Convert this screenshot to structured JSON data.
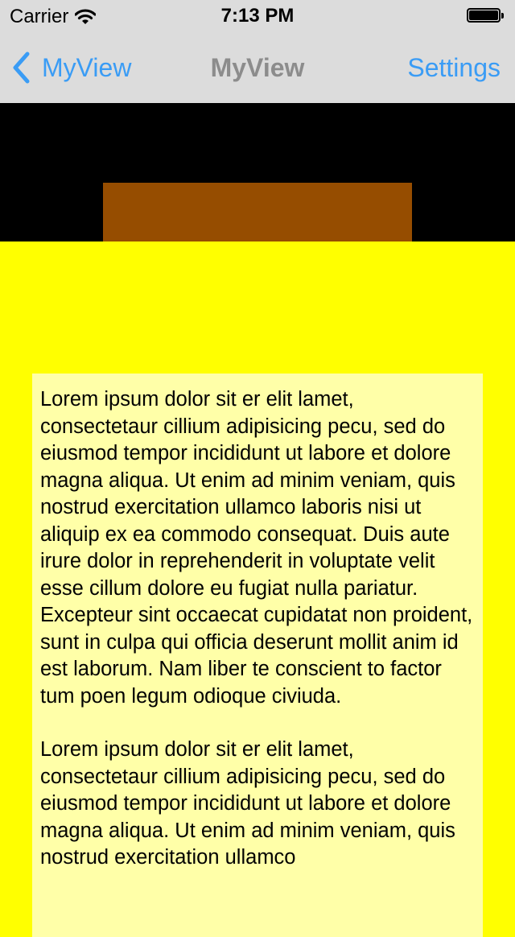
{
  "status_bar": {
    "carrier": "Carrier",
    "time": "7:13 PM",
    "wifi_icon": "wifi-icon",
    "battery_icon": "battery-icon"
  },
  "nav_bar": {
    "back_label": "MyView",
    "title": "MyView",
    "right_button": "Settings",
    "back_icon": "chevron-left-icon",
    "accent_color": "#3a9cf5",
    "bar_color": "#dcdcdc"
  },
  "colors": {
    "header_background": "#000000",
    "header_block": "#964d00",
    "content_background": "#ffff00",
    "text_panel_background": "#ffffa8"
  },
  "content": {
    "paragraphs": [
      "Lorem ipsum dolor sit er elit lamet, consectetaur cillium adipisicing pecu, sed do eiusmod tempor incididunt ut labore et dolore magna aliqua. Ut enim ad minim veniam, quis nostrud exercitation ullamco laboris nisi ut aliquip ex ea commodo consequat. Duis aute irure dolor in reprehenderit in voluptate velit esse cillum dolore eu fugiat nulla pariatur. Excepteur sint occaecat cupidatat non proident, sunt in culpa qui officia deserunt mollit anim id est laborum. Nam liber te conscient to factor tum poen legum odioque civiuda.",
      "Lorem ipsum dolor sit er elit lamet, consectetaur cillium adipisicing pecu, sed do eiusmod tempor incididunt ut labore et dolore magna aliqua. Ut enim ad minim veniam, quis nostrud exercitation ullamco"
    ]
  }
}
